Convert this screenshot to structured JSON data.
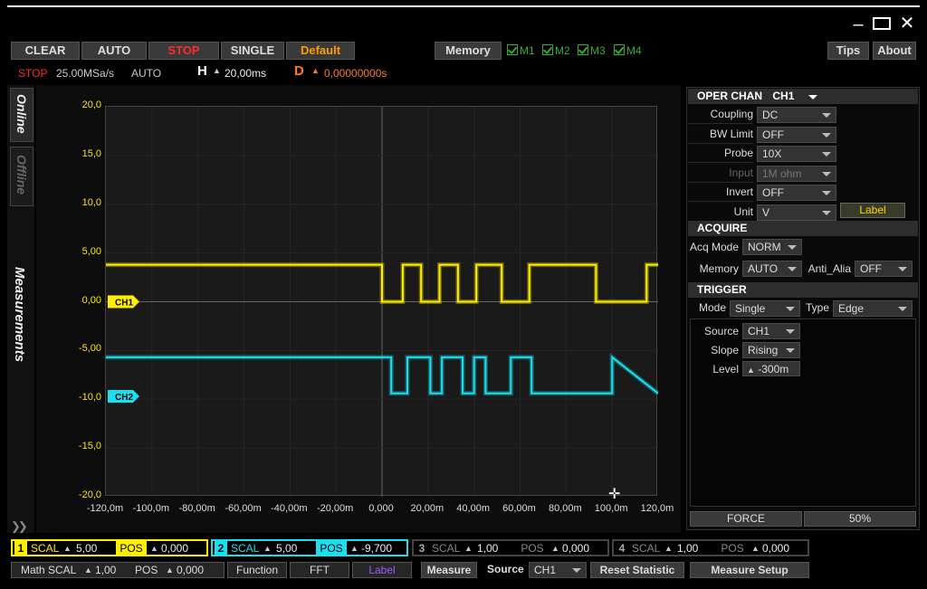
{
  "window": {
    "min_icon": "minimize-icon",
    "max_icon": "maximize-icon",
    "close_icon": "close-icon"
  },
  "toolbar": {
    "clear": "CLEAR",
    "auto": "AUTO",
    "stop": "STOP",
    "single": "SINGLE",
    "default": "Default",
    "memory": "Memory",
    "m1": "M1",
    "m2": "M2",
    "m3": "M3",
    "m4": "M4",
    "tips": "Tips",
    "about": "About"
  },
  "status": {
    "state": "STOP",
    "rate": "25.00MSa/s",
    "mode": "AUTO",
    "h_label": "H",
    "h_value": "20,00ms",
    "d_label": "D",
    "d_value": "0,00000000s"
  },
  "sidebar": {
    "online": "Online",
    "offline": "Offline",
    "measurements": "Measurements"
  },
  "chart_data": {
    "type": "line",
    "ylim": [
      -20,
      20
    ],
    "xlim": [
      -120,
      120
    ],
    "y_ticks": [
      "20,0",
      "15,0",
      "10,0",
      "5,00",
      "0,00",
      "-5,00",
      "-10,0",
      "-15,0",
      "-20,0"
    ],
    "x_ticks": [
      "-120,0m",
      "-100,0m",
      "-80,00m",
      "-60,00m",
      "-40,00m",
      "-20,00m",
      "0,000",
      "20,00m",
      "40,00m",
      "60,00m",
      "80,00m",
      "100,0m",
      "120,0m"
    ],
    "series": [
      {
        "name": "CH1",
        "color": "#ffee00",
        "x": [
          -120,
          0,
          0,
          9,
          9,
          17,
          17,
          25,
          25,
          33,
          33,
          41,
          41,
          52,
          52,
          64,
          64,
          93,
          93,
          115,
          115,
          120
        ],
        "y": [
          3.8,
          3.8,
          0,
          0,
          3.8,
          3.8,
          0,
          0,
          3.8,
          3.8,
          0,
          0,
          3.8,
          3.8,
          0,
          0,
          3.8,
          3.8,
          0,
          0,
          3.8,
          3.8
        ]
      },
      {
        "name": "CH2",
        "color": "#19e0ee",
        "x": [
          -120,
          0,
          0,
          4,
          4,
          11,
          11,
          21,
          21,
          26,
          26,
          35,
          35,
          40,
          40,
          45,
          45,
          56,
          56,
          65,
          65,
          100,
          100,
          120
        ],
        "y": [
          -5.7,
          -5.7,
          -5.7,
          -5.7,
          -9.4,
          -9.4,
          -5.7,
          -5.7,
          -9.4,
          -9.4,
          -5.7,
          -5.7,
          -9.4,
          -9.4,
          -5.7,
          -5.7,
          -9.4,
          -9.4,
          -5.7,
          -5.7,
          -9.4,
          -9.4,
          -5.7,
          -9.4
        ]
      }
    ],
    "markers": [
      {
        "label": "CH1",
        "color": "#ffee00"
      },
      {
        "label": "CH2",
        "color": "#19e0ee"
      }
    ]
  },
  "oper": {
    "title": "OPER CHAN",
    "channel": "CH1",
    "rows": [
      {
        "label": "Coupling",
        "value": "DC"
      },
      {
        "label": "BW Limit",
        "value": "OFF"
      },
      {
        "label": "Probe",
        "value": "10X"
      },
      {
        "label": "Input",
        "value": "1M ohm"
      },
      {
        "label": "Invert",
        "value": "OFF"
      },
      {
        "label": "Unit",
        "value": "V"
      }
    ],
    "label_btn": "Label"
  },
  "acquire": {
    "title": "ACQUIRE",
    "acq_mode_label": "Acq Mode",
    "acq_mode": "NORM",
    "memory_label": "Memory",
    "memory": "AUTO",
    "anti_label": "Anti_Alia",
    "anti": "OFF"
  },
  "trigger": {
    "title": "TRIGGER",
    "mode_label": "Mode",
    "mode": "Single",
    "type_label": "Type",
    "type": "Edge",
    "source_label": "Source",
    "source": "CH1",
    "slope_label": "Slope",
    "slope": "Rising",
    "level_label": "Level",
    "level": "-300m",
    "force": "FORCE",
    "pct": "50%"
  },
  "channels": [
    {
      "num": "1",
      "scal": "SCAL",
      "scal_v": "5,00",
      "pos": "POS",
      "pos_v": "0,000"
    },
    {
      "num": "2",
      "scal": "SCAL",
      "scal_v": "5,00",
      "pos": "POS",
      "pos_v": "-9,700"
    },
    {
      "num": "3",
      "scal": "SCAL",
      "scal_v": "1,00",
      "pos": "POS",
      "pos_v": "0,000"
    },
    {
      "num": "4",
      "scal": "SCAL",
      "scal_v": "1,00",
      "pos": "POS",
      "pos_v": "0,000"
    }
  ],
  "math": {
    "scal": "Math SCAL",
    "scal_v": "1,00",
    "pos": "POS",
    "pos_v": "0,000",
    "function": "Function",
    "fft": "FFT",
    "label": "Label"
  },
  "measure": {
    "measure": "Measure",
    "source_label": "Source",
    "source": "CH1",
    "reset": "Reset  Statistic",
    "setup": "Measure Setup"
  }
}
